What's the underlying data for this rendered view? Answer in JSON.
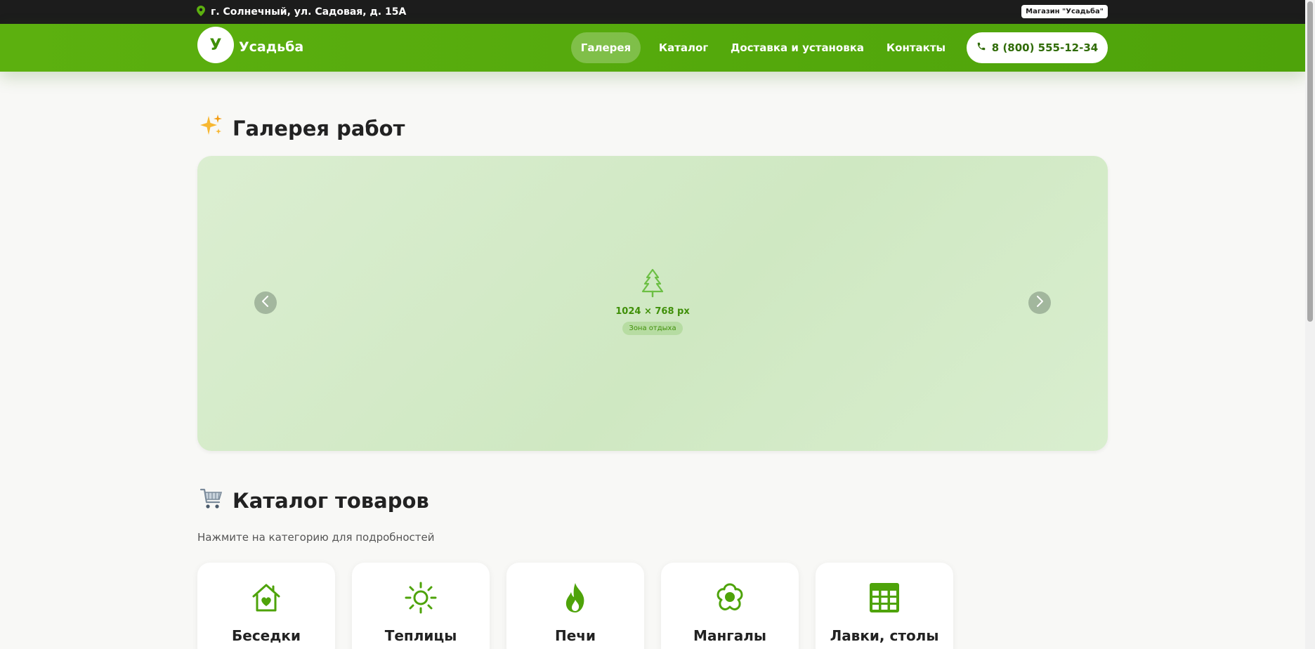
{
  "topbar": {
    "address": "г. Солнечный, ул. Садовая, д. 15А",
    "store_badge": "Магазин \"Усадьба\""
  },
  "header": {
    "logo_letter": "У",
    "brand": "Усадьба",
    "nav": [
      {
        "label": "Галерея",
        "active": true
      },
      {
        "label": "Каталог",
        "active": false
      },
      {
        "label": "Доставка и установка",
        "active": false
      },
      {
        "label": "Контакты",
        "active": false
      }
    ],
    "phone": "8 (800) 555-12-34"
  },
  "gallery": {
    "title": "Галерея работ",
    "title_icon": "sparkles-icon",
    "image_size": "1024 × 768 px",
    "image_tag": "Зона отдыха",
    "image_icon": "tree-icon"
  },
  "catalog": {
    "title": "Каталог товаров",
    "title_icon": "shopping-cart-icon",
    "subtitle": "Нажмите на категорию для подробностей",
    "categories": [
      {
        "label": "Беседки",
        "icon": "house-heart-icon"
      },
      {
        "label": "Теплицы",
        "icon": "sun-icon"
      },
      {
        "label": "Печи",
        "icon": "fire-icon"
      },
      {
        "label": "Мангалы",
        "icon": "flower-icon"
      },
      {
        "label": "Лавки, столы",
        "icon": "grid-table-icon"
      }
    ]
  },
  "colors": {
    "brand_green": "#5cb00f",
    "dark_green": "#3f8f08",
    "topbar": "#1c1c1c",
    "background": "#f8f8f6"
  }
}
